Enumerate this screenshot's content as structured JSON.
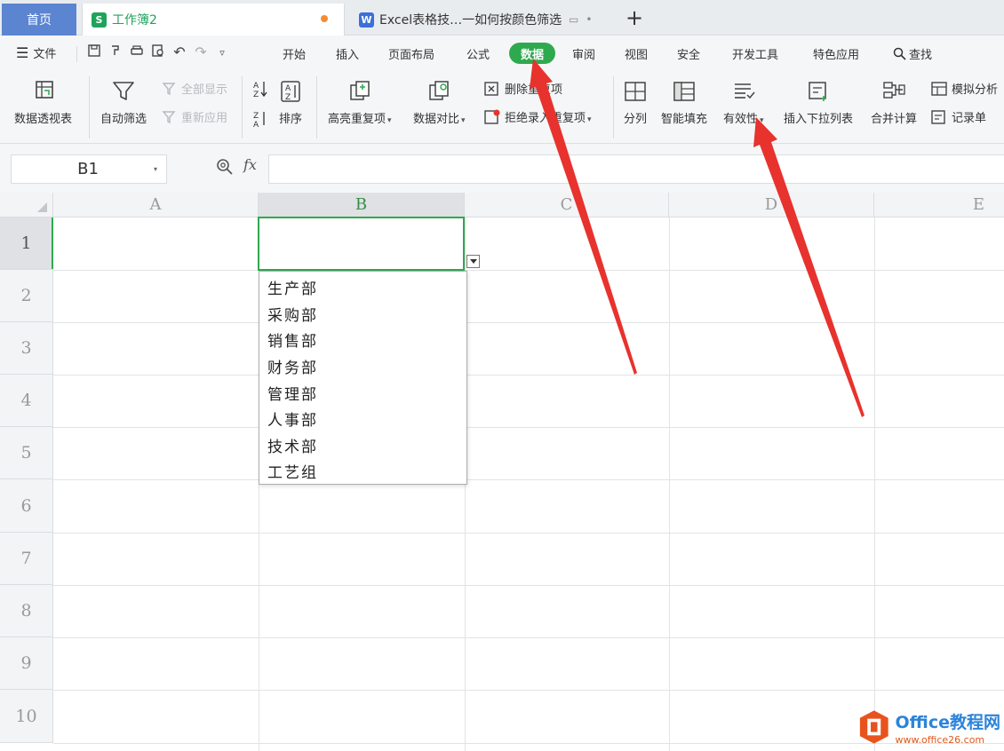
{
  "tabs": {
    "home": "首页",
    "workbook": "工作簿2",
    "document": "Excel表格技…一如何按颜色筛选"
  },
  "menu": {
    "file": "文件",
    "items": [
      "开始",
      "插入",
      "页面布局",
      "公式",
      "数据",
      "审阅",
      "视图",
      "安全",
      "开发工具",
      "特色应用",
      "查找"
    ],
    "active": "数据"
  },
  "ribbon": {
    "pivot": "数据透视表",
    "autofilter": "自动筛选",
    "show_all": "全部显示",
    "reapply": "重新应用",
    "sort": "排序",
    "highlight_dup": "高亮重复项",
    "compare": "数据对比",
    "remove_dup": "删除重复项",
    "reject_dup": "拒绝录入重复项",
    "split": "分列",
    "smart_fill": "智能填充",
    "validity": "有效性",
    "insert_dropdown": "插入下拉列表",
    "merge_calc": "合并计算",
    "whatif": "模拟分析",
    "record": "记录单"
  },
  "formula_bar": {
    "name_box": "B1",
    "fx": "fx",
    "value": ""
  },
  "sheet": {
    "columns": [
      "A",
      "B",
      "C",
      "D",
      "E"
    ],
    "rows": [
      "1",
      "2",
      "3",
      "4",
      "5",
      "6",
      "7",
      "8",
      "9",
      "10"
    ],
    "selected_cell": "B1"
  },
  "dropdown": {
    "options": [
      "生产部",
      "采购部",
      "销售部",
      "财务部",
      "管理部",
      "人事部",
      "技术部",
      "工艺组"
    ]
  },
  "watermark": {
    "brand": "Office教程网",
    "url": "www.office26.com"
  },
  "colors": {
    "accent_green": "#2fa94e",
    "home_tab": "#5b85d1",
    "arrow_red": "#e8322d"
  }
}
